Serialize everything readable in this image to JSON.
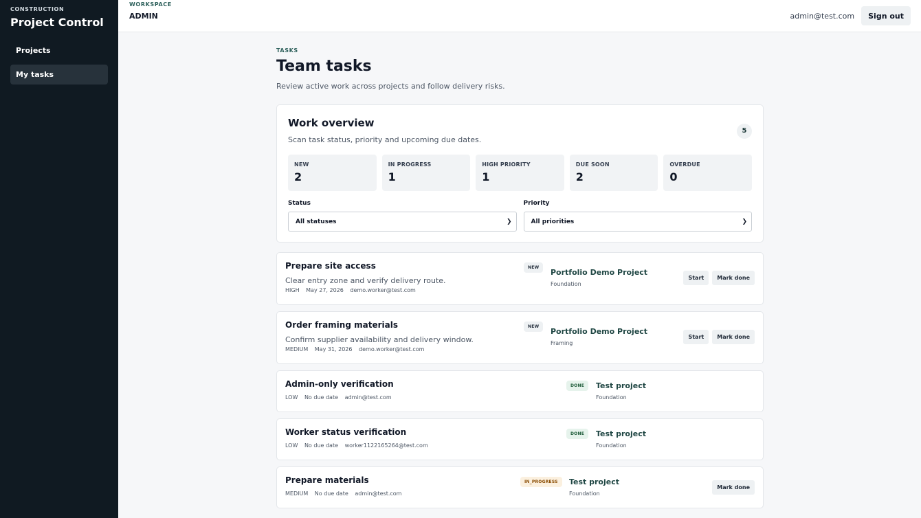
{
  "sidebar": {
    "kicker": "CONSTRUCTION",
    "title": "Project Control",
    "items": [
      {
        "label": "Projects"
      },
      {
        "label": "My tasks"
      }
    ]
  },
  "topbar": {
    "kicker": "WORKSPACE",
    "name": "ADMIN",
    "user_email": "admin@test.com",
    "signout_label": "Sign out"
  },
  "page": {
    "kicker": "TASKS",
    "title": "Team tasks",
    "subtitle": "Review active work across projects and follow delivery risks."
  },
  "overview": {
    "title": "Work overview",
    "subtitle": "Scan task status, priority and upcoming due dates.",
    "count": "5",
    "stats": [
      {
        "label": "NEW",
        "value": "2"
      },
      {
        "label": "IN PROGRESS",
        "value": "1"
      },
      {
        "label": "HIGH PRIORITY",
        "value": "1"
      },
      {
        "label": "DUE SOON",
        "value": "2"
      },
      {
        "label": "OVERDUE",
        "value": "0"
      }
    ],
    "filters": {
      "status_label": "Status",
      "status_value": "All statuses",
      "priority_label": "Priority",
      "priority_value": "All priorities"
    }
  },
  "tasks": [
    {
      "title": "Prepare site access",
      "description": "Clear entry zone and verify delivery route.",
      "priority": "HIGH",
      "due": "May 27, 2026",
      "assignee": "demo.worker@test.com",
      "status": "NEW",
      "project": "Portfolio Demo Project",
      "phase": "Foundation",
      "start_label": "Start",
      "done_label": "Mark done"
    },
    {
      "title": "Order framing materials",
      "description": "Confirm supplier availability and delivery window.",
      "priority": "MEDIUM",
      "due": "May 31, 2026",
      "assignee": "demo.worker@test.com",
      "status": "NEW",
      "project": "Portfolio Demo Project",
      "phase": "Framing",
      "start_label": "Start",
      "done_label": "Mark done"
    },
    {
      "title": "Admin-only verification",
      "priority": "LOW",
      "due": "No due date",
      "assignee": "admin@test.com",
      "status": "DONE",
      "project": "Test project",
      "phase": "Foundation"
    },
    {
      "title": "Worker status verification",
      "priority": "LOW",
      "due": "No due date",
      "assignee": "worker1122165264@test.com",
      "status": "DONE",
      "project": "Test project",
      "phase": "Foundation"
    },
    {
      "title": "Prepare materials",
      "priority": "MEDIUM",
      "due": "No due date",
      "assignee": "admin@test.com",
      "status": "IN_PROGRESS",
      "project": "Test project",
      "phase": "Foundation",
      "done_label": "Mark done"
    }
  ]
}
